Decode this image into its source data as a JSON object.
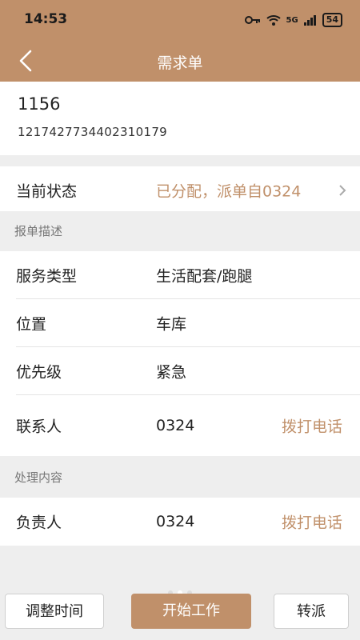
{
  "status_bar": {
    "time": "14:53",
    "network": "5G",
    "battery": "54"
  },
  "header": {
    "title": "需求单"
  },
  "order": {
    "id": "1156",
    "number": "1217427734402310179"
  },
  "current_status": {
    "label": "当前状态",
    "value": "已分配，派单自0324"
  },
  "section_report": {
    "title": "报单描述"
  },
  "fields": {
    "service_type": {
      "label": "服务类型",
      "value": "生活配套/跑腿"
    },
    "location": {
      "label": "位置",
      "value": "车库"
    },
    "priority": {
      "label": "优先级",
      "value": "紧急"
    },
    "contact": {
      "label": "联系人",
      "value": "0324",
      "action": "拨打电话"
    }
  },
  "section_process": {
    "title": "处理内容"
  },
  "owner": {
    "label": "负责人",
    "value": "0324",
    "action": "拨打电话"
  },
  "actions": {
    "adjust_time": "调整时间",
    "start_work": "开始工作",
    "transfer": "转派"
  },
  "colors": {
    "accent": "#c0906a",
    "background": "#eeeeee"
  }
}
